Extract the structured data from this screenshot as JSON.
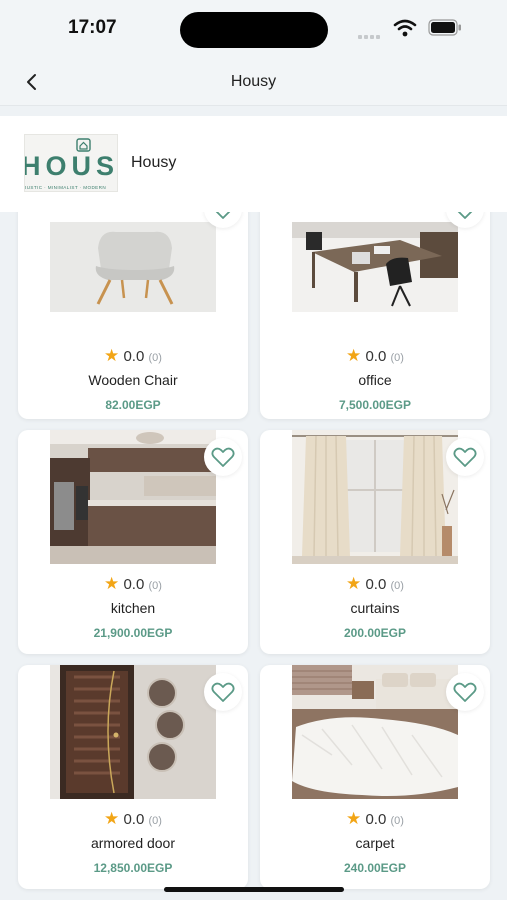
{
  "status": {
    "time": "17:07"
  },
  "nav": {
    "title": "Housy"
  },
  "store": {
    "name": "Housy",
    "logo_text": "HOUSY",
    "logo_tagline": "RUSTIC · MINIMALIST · MODERN"
  },
  "products": [
    {
      "name": "Wooden Chair",
      "rating": "0.0",
      "reviews": "(0)",
      "price": "82.00EGP"
    },
    {
      "name": "office",
      "rating": "0.0",
      "reviews": "(0)",
      "price": "7,500.00EGP"
    },
    {
      "name": "kitchen",
      "rating": "0.0",
      "reviews": "(0)",
      "price": "21,900.00EGP"
    },
    {
      "name": "curtains",
      "rating": "0.0",
      "reviews": "(0)",
      "price": "200.00EGP"
    },
    {
      "name": "armored door",
      "rating": "0.0",
      "reviews": "(0)",
      "price": "12,850.00EGP"
    },
    {
      "name": "carpet",
      "rating": "0.0",
      "reviews": "(0)",
      "price": "240.00EGP"
    }
  ],
  "colors": {
    "accent": "#5b9a87",
    "star": "#f2a516",
    "background": "#eef2f5"
  },
  "icons": {
    "back": "chevron-left-icon",
    "favorite": "heart-outline-icon",
    "star": "star-icon"
  }
}
